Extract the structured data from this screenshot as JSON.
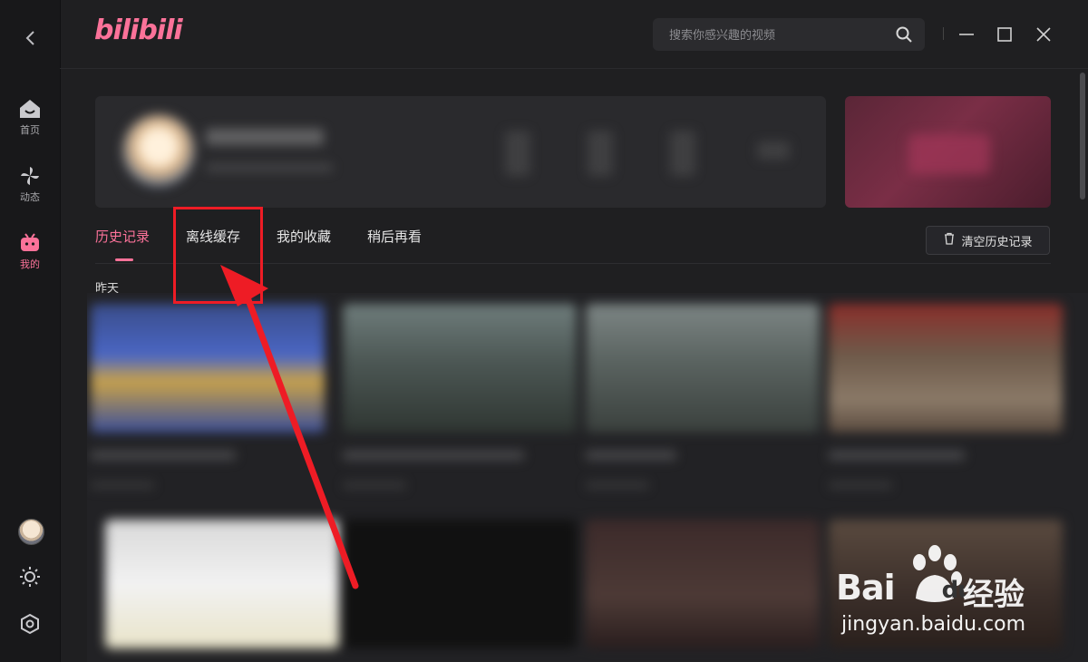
{
  "app": {
    "logo_text": "bilibili",
    "brand_color": "#fb7299"
  },
  "search": {
    "placeholder": "搜索你感兴趣的视频"
  },
  "sidebar": {
    "items": [
      {
        "label": "首页",
        "icon": "home-icon"
      },
      {
        "label": "动态",
        "icon": "pinwheel-icon"
      },
      {
        "label": "我的",
        "icon": "tv-icon",
        "active": true
      }
    ],
    "bottom_icons": [
      "avatar",
      "sun-icon",
      "settings-icon"
    ]
  },
  "tabs": [
    {
      "label": "历史记录",
      "active": true
    },
    {
      "label": "离线缓存"
    },
    {
      "label": "我的收藏"
    },
    {
      "label": "稍后再看"
    }
  ],
  "actions": {
    "clear_history_label": "清空历史记录"
  },
  "history": {
    "section_label": "昨天"
  },
  "annotation": {
    "highlight_color": "#ee1c25",
    "target_tab": "离线缓存"
  },
  "watermark": {
    "brand": "Bai",
    "brand_suffix": "du",
    "product": "经验",
    "url": "jingyan.baidu.com"
  }
}
